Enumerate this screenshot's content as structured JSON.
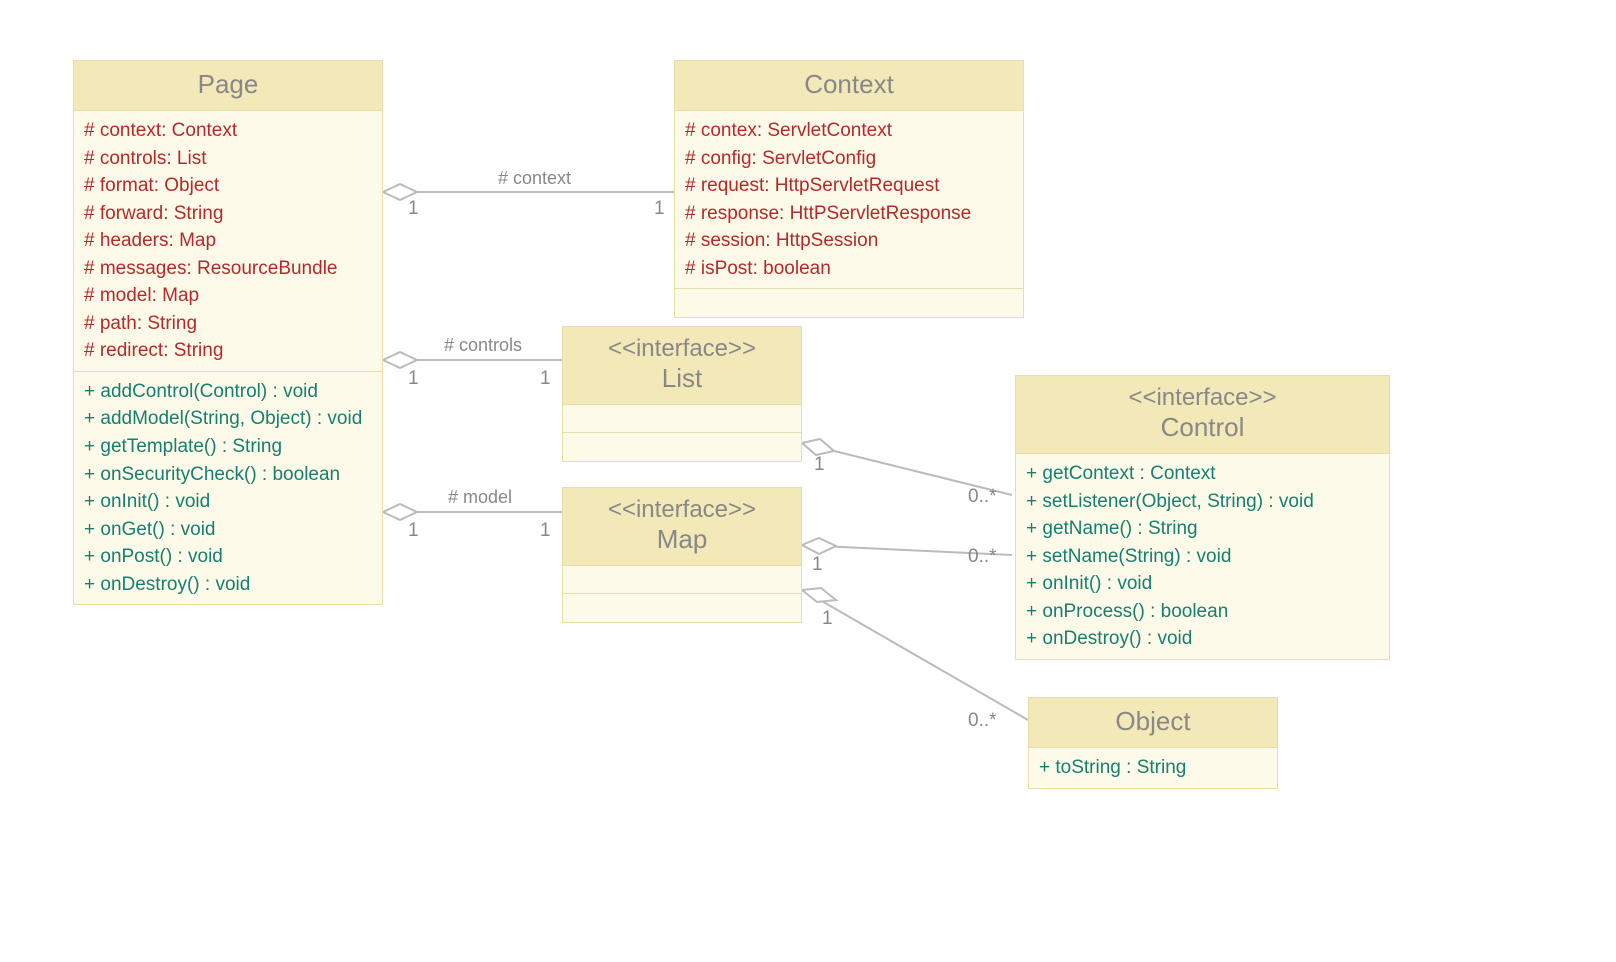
{
  "classes": {
    "page": {
      "name": "Page",
      "attrs": [
        "# context: Context",
        "# controls: List",
        "# format: Object",
        "# forward: String",
        "# headers: Map",
        "# messages: ResourceBundle",
        "# model: Map",
        "# path: String",
        "# redirect: String"
      ],
      "methods": [
        "+ addControl(Control) : void",
        "+ addModel(String, Object) : void",
        "+ getTemplate() : String",
        "+ onSecurityCheck() : boolean",
        "+ onInit() : void",
        "+ onGet() : void",
        "+ onPost() : void",
        "+ onDestroy() : void"
      ]
    },
    "context": {
      "name": "Context",
      "attrs": [
        "# contex: ServletContext",
        "# config: ServletConfig",
        "# request: HttpServletRequest",
        "# response: HttPServletResponse",
        "# session: HttpSession",
        "# isPost: boolean"
      ]
    },
    "list": {
      "stereotype": "<<interface>>",
      "name": "List"
    },
    "map": {
      "stereotype": "<<interface>>",
      "name": "Map"
    },
    "control": {
      "stereotype": "<<interface>>",
      "name": "Control",
      "methods": [
        "+ getContext : Context",
        "+ setListener(Object, String) : void",
        "+ getName() : String",
        "+ setName(String) : void",
        "+ onInit() : void",
        "+ onProcess() : boolean",
        "+ onDestroy() : void"
      ]
    },
    "object": {
      "name": "Object",
      "methods": [
        "+ toString : String"
      ]
    }
  },
  "edges": {
    "context_label": "# context",
    "controls_label": "# controls",
    "model_label": "# model",
    "one": "1",
    "many": "0..*"
  }
}
